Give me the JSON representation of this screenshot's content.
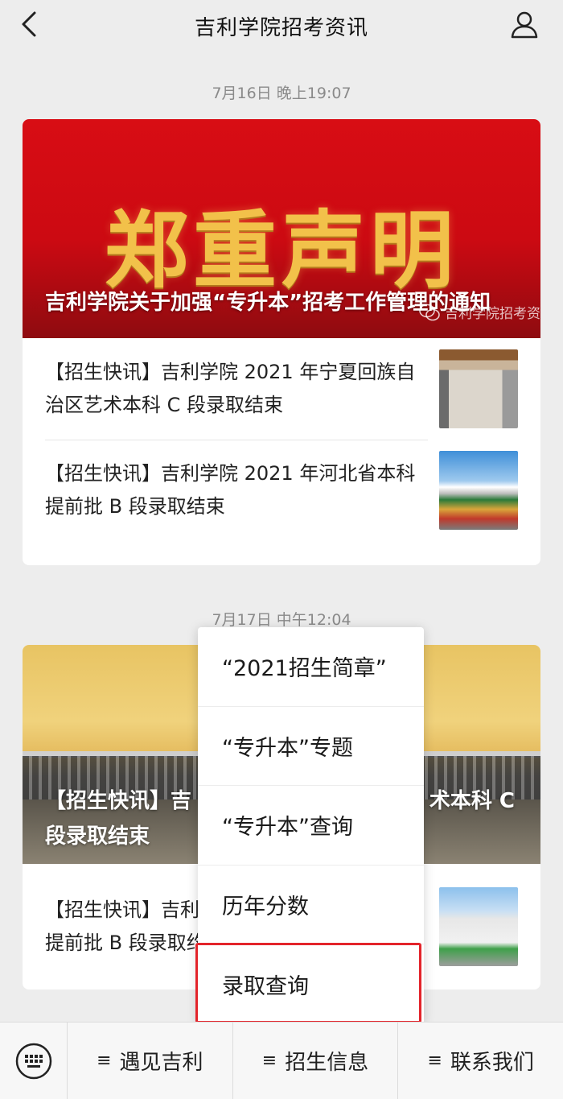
{
  "header": {
    "title": "吉利学院招考资讯",
    "back_icon": "chevron-left-icon",
    "profile_icon": "person-icon"
  },
  "feed": [
    {
      "timestamp": "7月16日 晚上19:07",
      "cover": {
        "big_text": "郑重声明",
        "title": "吉利学院关于加强“专升本”招考工作管理的通知",
        "watermark": "吉利学院招考资"
      },
      "items": [
        {
          "text": "【招生快讯】吉利学院 2021 年宁夏回族自治区艺术本科 C 段录取结束"
        },
        {
          "text": "【招生快讯】吉利学院 2021 年河北省本科提前批 B 段录取结束"
        }
      ]
    },
    {
      "timestamp": "7月17日 中午12:04",
      "cover": {
        "title_left": "【招生快讯】吉",
        "title_right": "术本科 C",
        "title_line2": "段录取结束"
      },
      "items": [
        {
          "text_line1": "【招生快讯】吉利",
          "text_line2": "提前批 B 段录取约"
        }
      ]
    }
  ],
  "popup_menu": {
    "items": [
      {
        "label": "“2021招生简章”"
      },
      {
        "label": "“专升本”专题"
      },
      {
        "label": "“专升本”查询"
      },
      {
        "label": "历年分数"
      },
      {
        "label": "录取查询"
      }
    ],
    "highlighted_index": 4,
    "highlight_color": "#e3242b"
  },
  "bottom_bar": {
    "keyboard_icon": "keyboard-icon",
    "tabs": [
      {
        "label": "遇见吉利",
        "icon": "≡"
      },
      {
        "label": "招生信息",
        "icon": "≡"
      },
      {
        "label": "联系我们",
        "icon": "≡"
      }
    ]
  }
}
